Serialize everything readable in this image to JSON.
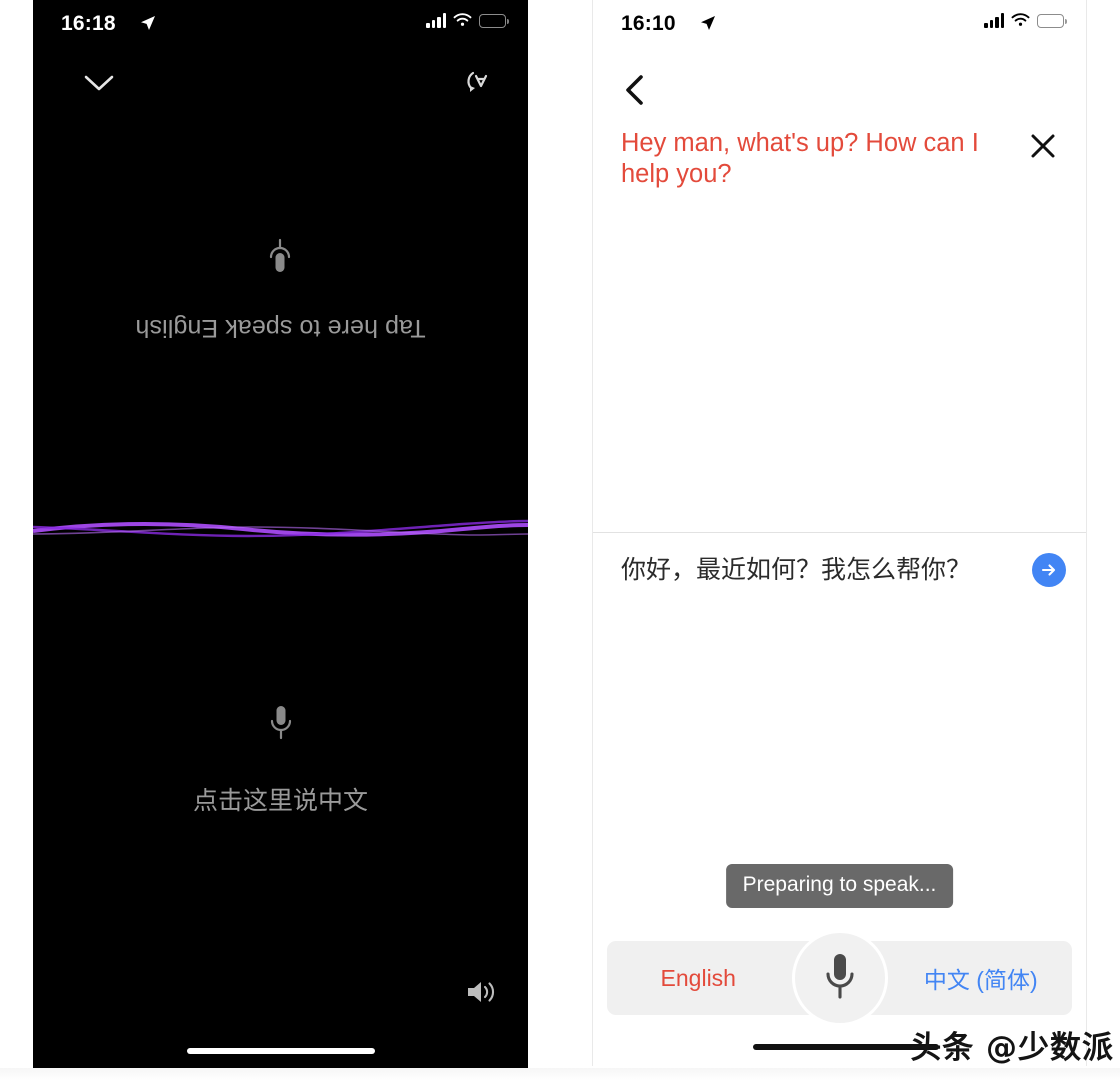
{
  "left_phone": {
    "status_bar": {
      "time": "16:18",
      "location_icon": "location-arrow-icon",
      "signal_icon": "signal-bars-icon",
      "wifi_icon": "wifi-icon",
      "battery_icon": "battery-full-icon"
    },
    "nav": {
      "collapse_icon": "chevron-down-icon",
      "rotate_icon": "rotate-screen-icon"
    },
    "flipped_panel": {
      "prompt": "Tap here to speak English",
      "mic_icon": "microphone-icon"
    },
    "divider": {
      "type": "audio-waveform",
      "color": "#a54af0"
    },
    "normal_panel": {
      "prompt": "点击这里说中文",
      "mic_icon": "microphone-icon"
    },
    "speaker_icon": "speaker-volume-icon",
    "home_indicator": "home-indicator"
  },
  "right_phone": {
    "status_bar": {
      "time": "16:10",
      "location_icon": "location-arrow-icon",
      "signal_icon": "signal-bars-icon",
      "wifi_icon": "wifi-icon",
      "battery_icon": "battery-full-icon"
    },
    "nav": {
      "back_icon": "chevron-left-icon",
      "close_icon": "close-x-icon"
    },
    "source_text": "Hey man, what's up? How can I help you?",
    "source_color": "#e34a3b",
    "target_text": "你好，最近如何？我怎么帮你？",
    "send_icon": "arrow-right-circle-icon",
    "send_color": "#4285f4",
    "toast": "Preparing to speak...",
    "language_bar": {
      "left_label": "English",
      "left_color": "#e34a3b",
      "right_label": "中文 (简体)",
      "right_color": "#4285f4",
      "mic_icon": "microphone-icon"
    },
    "home_indicator": "home-indicator"
  },
  "watermark": {
    "text": "头条 @少数派"
  }
}
